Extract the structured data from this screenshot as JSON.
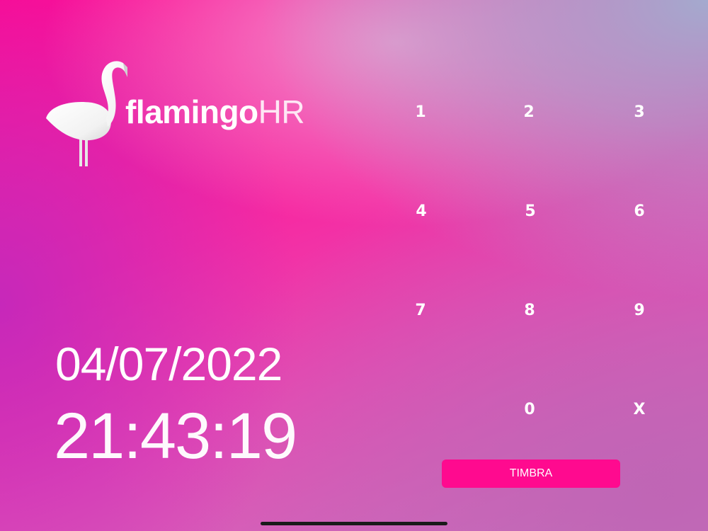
{
  "logo": {
    "bold": "flamingo",
    "light": "HR"
  },
  "clock": {
    "date": "04/07/2022",
    "time": "21:43:19"
  },
  "keypad": {
    "k1": "1",
    "k2": "2",
    "k3": "3",
    "k4": "4",
    "k5": "5",
    "k6": "6",
    "k7": "7",
    "k8": "8",
    "k9": "9",
    "k0": "0",
    "clear": "X"
  },
  "submit": {
    "label": "TIMBRA",
    "color": "#ff0a8f"
  },
  "colors": {
    "background_start": "#ff0a93",
    "background_end": "#a4aace",
    "text": "#ffffff"
  },
  "icons": {
    "logo": "flamingo-icon"
  }
}
